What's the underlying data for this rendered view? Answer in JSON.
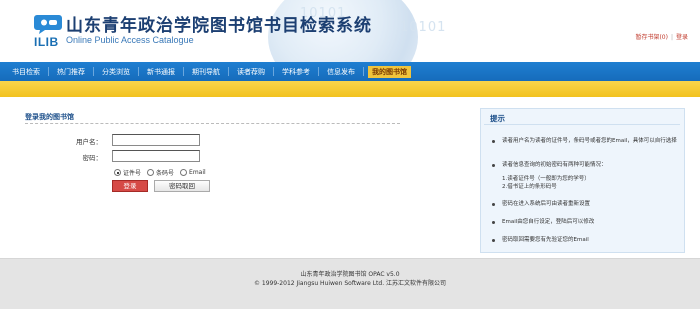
{
  "header": {
    "title_cn": "山东青年政治学院图书馆书目检索系统",
    "title_en": "Online Public Access Catalogue",
    "logo_text": "ILIB",
    "bg_numbers": "10101",
    "toplinks": {
      "cart": "暂存书架(0)",
      "login": "登录"
    }
  },
  "nav": {
    "items": [
      "书目检索",
      "热门推荐",
      "分类浏览",
      "新书通报",
      "期刊导航",
      "读者荐购",
      "学科参考",
      "信息发布",
      "我的图书馆"
    ],
    "active_index": 8
  },
  "login": {
    "title": "登录我的图书馆",
    "username_label": "用户名：",
    "password_label": "密码：",
    "username_value": "",
    "password_value": "",
    "radio_options": [
      "证件号",
      "条码号",
      "Email"
    ],
    "selected_radio": 0,
    "login_button": "登录",
    "reset_button": "密码取回"
  },
  "tips": {
    "title": "提示",
    "items": [
      "读者用户名为读者的证件号，条码号或者您的Email，具体可以自行选择",
      "读者信息查询的初始密码有两种可能情况：",
      "1.读者证件号（一般即为您的学号）\n2.借书证上的条形码号",
      "密码在进入系统后可由读者重新设置",
      "Email由您自行设定，登陆后可以修改",
      "密码取回需要您有先验证您的Email"
    ]
  },
  "footer": {
    "line1": "山东青年政治学院图书馆   OPAC v5.0",
    "line2": "© 1999-2012 Jiangsu Huiwen Software Ltd. 江苏汇文软件有限公司"
  },
  "colors": {
    "nav_blue": "#1773c4",
    "yellow_bar": "#f4c72a",
    "login_red": "#d64a46",
    "title_blue": "#1c3f72"
  }
}
